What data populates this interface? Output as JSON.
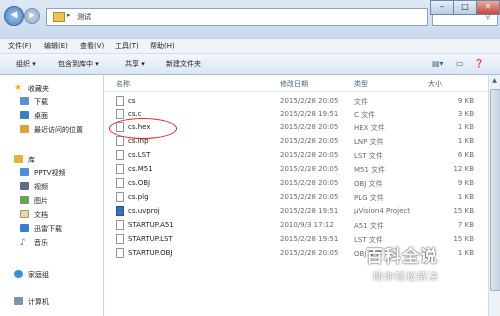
{
  "window": {
    "address_path": "测试"
  },
  "menubar": {
    "items": [
      "文件(F)",
      "编辑(E)",
      "查看(V)",
      "工具(T)",
      "帮助(H)"
    ]
  },
  "toolbar": {
    "items": [
      "组织 ▾",
      "包含到库中 ▾",
      "共享 ▾",
      "新建文件夹"
    ]
  },
  "navpane": {
    "favorites": {
      "label": "收藏夹",
      "items": [
        "下载",
        "桌面",
        "最近访问的位置"
      ]
    },
    "libraries": {
      "label": "库",
      "items": [
        "PPTV视频",
        "视频",
        "图片",
        "文档",
        "迅雷下载",
        "音乐"
      ]
    },
    "homegroup": "家庭组",
    "computer": "计算机"
  },
  "filelist": {
    "columns": {
      "name": "名称",
      "date": "修改日期",
      "type": "类型",
      "size": "大小"
    },
    "rows": [
      {
        "name": "cs",
        "date": "2015/2/28 20:05",
        "type": "文件",
        "size": "9 KB"
      },
      {
        "name": "cs.c",
        "date": "2015/2/28 19:51",
        "type": "C 文件",
        "size": "3 KB"
      },
      {
        "name": "cs.hex",
        "date": "2015/2/28 20:05",
        "type": "HEX 文件",
        "size": "1 KB"
      },
      {
        "name": "cs.lnp",
        "date": "2015/2/28 20:05",
        "type": "LNP 文件",
        "size": "1 KB"
      },
      {
        "name": "cs.LST",
        "date": "2015/2/28 20:05",
        "type": "LST 文件",
        "size": "6 KB"
      },
      {
        "name": "cs.M51",
        "date": "2015/2/28 20:05",
        "type": "M51 文件",
        "size": "12 KB"
      },
      {
        "name": "cs.OBJ",
        "date": "2015/2/28 20:05",
        "type": "OBJ 文件",
        "size": "9 KB"
      },
      {
        "name": "cs.plg",
        "date": "2015/2/28 20:05",
        "type": "PLG 文件",
        "size": "1 KB"
      },
      {
        "name": "cs.uvproj",
        "date": "2015/2/28 19:51",
        "type": "μVision4 Project",
        "size": "15 KB"
      },
      {
        "name": "STARTUP.A51",
        "date": "2010/9/3 17:12",
        "type": "A51 文件",
        "size": "7 KB"
      },
      {
        "name": "STARTUP.LST",
        "date": "2015/2/28 19:51",
        "type": "LST 文件",
        "size": "15 KB"
      },
      {
        "name": "STARTUP.OBJ",
        "date": "2015/2/28 20:05",
        "type": "OBJ 文件",
        "size": "1 KB"
      }
    ]
  },
  "watermark": {
    "main": "百科全说",
    "sub": "助你轻松解决"
  },
  "colors": {
    "annotation": "#e02323",
    "folder": "#e8c45a"
  }
}
